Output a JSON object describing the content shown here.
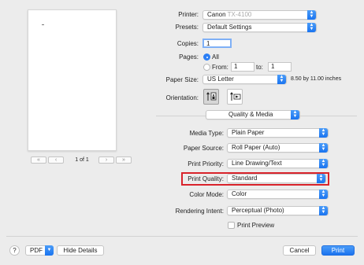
{
  "preview": {
    "pager": {
      "first": "«",
      "prev": "‹",
      "page_text": "1 of 1",
      "next": "›",
      "last": "»"
    }
  },
  "printer": {
    "label": "Printer:",
    "value": "Canon",
    "model_blurred": "TX-4100"
  },
  "presets": {
    "label": "Presets:",
    "value": "Default Settings"
  },
  "copies": {
    "label": "Copies:",
    "value": "1"
  },
  "pages": {
    "label": "Pages:",
    "all_label": "All",
    "from_label": "From:",
    "from_value": "1",
    "to_label": "to:",
    "to_value": "1",
    "selected": "All"
  },
  "paper_size": {
    "label": "Paper Size:",
    "value": "US Letter",
    "dimensions": "8.50 by 11.00 inches"
  },
  "orientation": {
    "label": "Orientation:",
    "selected": "portrait"
  },
  "section_popup": {
    "value": "Quality & Media"
  },
  "media_type": {
    "label": "Media Type:",
    "value": "Plain Paper"
  },
  "paper_source": {
    "label": "Paper Source:",
    "value": "Roll Paper (Auto)"
  },
  "print_priority": {
    "label": "Print Priority:",
    "value": "Line Drawing/Text"
  },
  "print_quality": {
    "label": "Print Quality:",
    "value": "Standard"
  },
  "color_mode": {
    "label": "Color Mode:",
    "value": "Color"
  },
  "rendering_intent": {
    "label": "Rendering Intent:",
    "value": "Perceptual (Photo)"
  },
  "print_preview": {
    "label": "Print Preview",
    "checked": false
  },
  "footer": {
    "help": "?",
    "pdf_label": "PDF",
    "hide_details": "Hide Details",
    "cancel": "Cancel",
    "print": "Print"
  },
  "colors": {
    "accent": "#2b7ef5",
    "highlight": "#d9232b",
    "background": "#ececec"
  }
}
